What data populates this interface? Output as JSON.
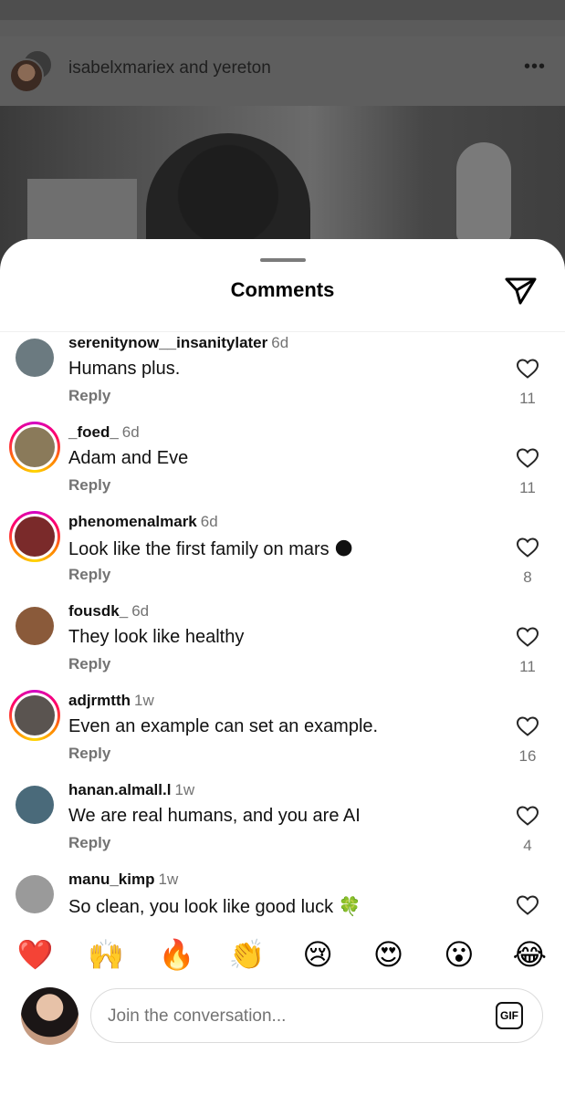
{
  "background_post": {
    "header_text": "isabelxmariex and yereton",
    "more_icon": "more-horizontal-icon"
  },
  "sheet": {
    "title": "Comments",
    "send_icon": "paper-plane-icon"
  },
  "comments": [
    {
      "username": "serenitynow__insanitylater",
      "age": "6d",
      "text": "Humans plus.",
      "reply": "Reply",
      "likes": "11",
      "ring": false,
      "avatar_color": "#6b7a80"
    },
    {
      "username": "_foed_",
      "age": "6d",
      "text": "Adam and Eve",
      "reply": "Reply",
      "likes": "11",
      "ring": true,
      "avatar_color": "#8a7a5a"
    },
    {
      "username": "phenomenalmark",
      "age": "6d",
      "text": "Look like the first family on mars 🌑",
      "reply": "Reply",
      "likes": "8",
      "ring": true,
      "avatar_color": "#7a2a2a"
    },
    {
      "username": "fousdk_",
      "age": "6d",
      "text": "They look like healthy",
      "reply": "Reply",
      "likes": "11",
      "ring": false,
      "avatar_color": "#8a5a3a"
    },
    {
      "username": "adjrmtth",
      "age": "1w",
      "text": "Even an example can set an example.",
      "reply": "Reply",
      "likes": "16",
      "ring": true,
      "avatar_color": "#5a5450"
    },
    {
      "username": "hanan.almall.l",
      "age": "1w",
      "text": "We are real humans, and you are AI",
      "reply": "Reply",
      "likes": "4",
      "ring": false,
      "avatar_color": "#4a6a7a"
    },
    {
      "username": "manu_kimp",
      "age": "1w",
      "text": "So clean, you look like good luck 🍀",
      "reply": "",
      "likes": "",
      "ring": false,
      "avatar_color": "#9a9a9a"
    }
  ],
  "reactions": [
    "❤️",
    "🙌",
    "🔥",
    "👏",
    "😢",
    "😍",
    "😮",
    "😂"
  ],
  "composer": {
    "placeholder": "Join the conversation...",
    "gif_label": "GIF"
  }
}
